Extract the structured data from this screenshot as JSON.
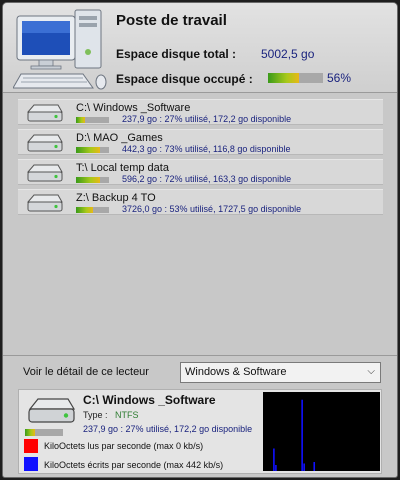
{
  "header": {
    "title": "Poste de travail",
    "total_label": "Espace disque total  :",
    "total_value": "5002,5 go",
    "used_label": "Espace disque occupé :",
    "used_value": "56%",
    "used_fraction": 0.56
  },
  "drives": [
    {
      "name": "C:\\ Windows _Software",
      "info": "237,9 go : 27% utilisé, 172,2 go disponible",
      "usage": 0.27
    },
    {
      "name": "D:\\ MAO _Games",
      "info": "442,3 go : 73% utilisé, 116,8 go disponible",
      "usage": 0.73
    },
    {
      "name": "T:\\ Local temp data",
      "info": "596,2 go : 72% utilisé, 163,3 go disponible",
      "usage": 0.72
    },
    {
      "name": "Z:\\ Backup 4 TO",
      "info": "3726,0 go : 53% utilisé, 1727,5 go disponible",
      "usage": 0.53
    }
  ],
  "detail": {
    "label": "Voir le détail de ce lecteur",
    "selected": "Windows & Software",
    "name": "C:\\ Windows _Software",
    "type_label": "Type :",
    "type_value": "NTFS",
    "info": "237,9 go : 27% utilisé, 172,2 go disponible",
    "usage": 0.27,
    "read_label": "KiloOctets lus par seconde  (max 0 kb/s)",
    "write_label": "KiloOctets écrits par seconde  (max 442 kb/s)"
  },
  "colors": {
    "read": "#ff0000",
    "write": "#1010ff"
  },
  "graph": {
    "read_values": [],
    "write_values": [
      0,
      0,
      0,
      0,
      0,
      30,
      8,
      0,
      0,
      0,
      0,
      0,
      0,
      0,
      0,
      0,
      0,
      0,
      0,
      95,
      10,
      0,
      0,
      0,
      0,
      12,
      0,
      0,
      0,
      0,
      0,
      0,
      0,
      0,
      0,
      0,
      0,
      0,
      0,
      0,
      0,
      0,
      0,
      0,
      0,
      0,
      0,
      0,
      0,
      0,
      0,
      0,
      0,
      0,
      0,
      0,
      0,
      0
    ]
  }
}
